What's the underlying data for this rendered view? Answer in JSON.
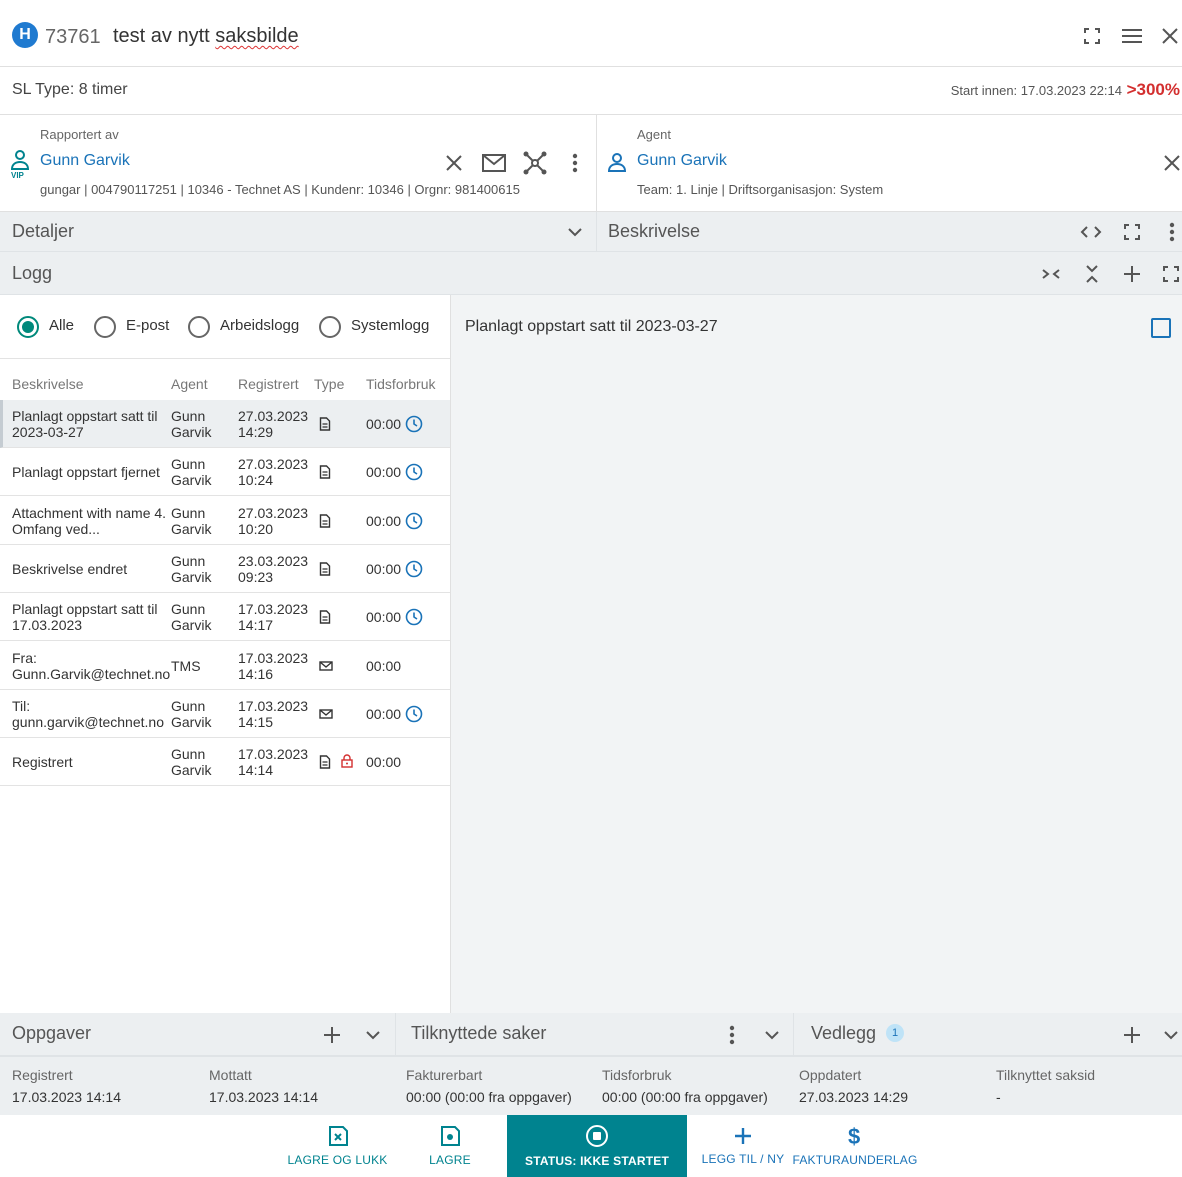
{
  "header": {
    "badge": "H",
    "case_id": "73761",
    "title_prefix": "test av nytt ",
    "title_spell": "saksbilde"
  },
  "sl": {
    "type": "SL Type: 8 timer",
    "start_innen": "Start innen: 17.03.2023 22:14",
    "overdue_pct": ">300%"
  },
  "reporter": {
    "label": "Rapportert av",
    "name": "Gunn Garvik",
    "vip": "VIP",
    "meta": "gungar | 004790117251 | 10346 - Technet AS | Kundenr: 10346 | Orgnr: 981400615"
  },
  "agent": {
    "label": "Agent",
    "name": "Gunn Garvik",
    "meta": "Team: 1. Linje | Driftsorganisasjon: System"
  },
  "sections": {
    "detaljer": "Detaljer",
    "beskrivelse": "Beskrivelse",
    "logg": "Logg"
  },
  "log_filters": [
    {
      "label": "Alle",
      "checked": true
    },
    {
      "label": "E-post",
      "checked": false
    },
    {
      "label": "Arbeidslogg",
      "checked": false
    },
    {
      "label": "Systemlogg",
      "checked": false
    }
  ],
  "log_columns": [
    "Beskrivelse",
    "Agent",
    "Registrert",
    "Type",
    "Tidsforbruk"
  ],
  "log_rows": [
    {
      "desc": [
        "Planlagt oppstart satt til",
        "2023-03-27"
      ],
      "agent": [
        "Gunn",
        "Garvik"
      ],
      "date": "27.03.2023",
      "time": "14:29",
      "type": "document",
      "locked": false,
      "tid": "00:00",
      "clock": true,
      "selected": true
    },
    {
      "desc": [
        "Planlagt oppstart fjernet"
      ],
      "agent": [
        "Gunn",
        "Garvik"
      ],
      "date": "27.03.2023",
      "time": "10:24",
      "type": "document",
      "locked": false,
      "tid": "00:00",
      "clock": true,
      "selected": false
    },
    {
      "desc": [
        "Attachment with name 4.",
        "Omfang ved..."
      ],
      "agent": [
        "Gunn",
        "Garvik"
      ],
      "date": "27.03.2023",
      "time": "10:20",
      "type": "document",
      "locked": false,
      "tid": "00:00",
      "clock": true,
      "selected": false
    },
    {
      "desc": [
        "Beskrivelse endret"
      ],
      "agent": [
        "Gunn",
        "Garvik"
      ],
      "date": "23.03.2023",
      "time": "09:23",
      "type": "document",
      "locked": false,
      "tid": "00:00",
      "clock": true,
      "selected": false
    },
    {
      "desc": [
        "Planlagt oppstart satt til",
        "17.03.2023"
      ],
      "agent": [
        "Gunn",
        "Garvik"
      ],
      "date": "17.03.2023",
      "time": "14:17",
      "type": "document",
      "locked": false,
      "tid": "00:00",
      "clock": true,
      "selected": false
    },
    {
      "desc": [
        "Fra:",
        "Gunn.Garvik@technet.no"
      ],
      "agent": [
        "TMS"
      ],
      "date": "17.03.2023",
      "time": "14:16",
      "type": "email",
      "locked": false,
      "tid": "00:00",
      "clock": false,
      "selected": false
    },
    {
      "desc": [
        "Til:",
        "gunn.garvik@technet.no"
      ],
      "agent": [
        "Gunn",
        "Garvik"
      ],
      "date": "17.03.2023",
      "time": "14:15",
      "type": "email",
      "locked": false,
      "tid": "00:00",
      "clock": true,
      "selected": false
    },
    {
      "desc": [
        "Registrert"
      ],
      "agent": [
        "Gunn",
        "Garvik"
      ],
      "date": "17.03.2023",
      "time": "14:14",
      "type": "document",
      "locked": true,
      "tid": "00:00",
      "clock": false,
      "selected": false
    }
  ],
  "log_detail": {
    "text": "Planlagt oppstart satt til 2023-03-27"
  },
  "bottom_sections": {
    "oppgaver": "Oppgaver",
    "tilknyttede": "Tilknyttede saker",
    "vedlegg": "Vedlegg",
    "vedlegg_count": "1"
  },
  "dates": [
    {
      "label": "Registrert",
      "value": "17.03.2023 14:14"
    },
    {
      "label": "Mottatt",
      "value": "17.03.2023 14:14"
    },
    {
      "label": "Fakturerbart",
      "value": "00:00 (00:00 fra oppgaver)"
    },
    {
      "label": "Tidsforbruk",
      "value": "00:00 (00:00 fra oppgaver)"
    },
    {
      "label": "Oppdatert",
      "value": "27.03.2023 14:29"
    },
    {
      "label": "Tilknyttet saksid",
      "value": "-"
    }
  ],
  "footer": {
    "lagre_lukk": "LAGRE OG LUKK",
    "lagre": "LAGRE",
    "status": "STATUS: IKKE STARTET",
    "legg_til": "LEGG TIL / NY",
    "faktura": "FAKTURAUNDERLAG"
  },
  "colors": {
    "accent": "#00838f",
    "link": "#1a73b8",
    "badge": "#1f7ad0",
    "overdue": "#d32f2f",
    "header_bg": "#eceff1"
  }
}
